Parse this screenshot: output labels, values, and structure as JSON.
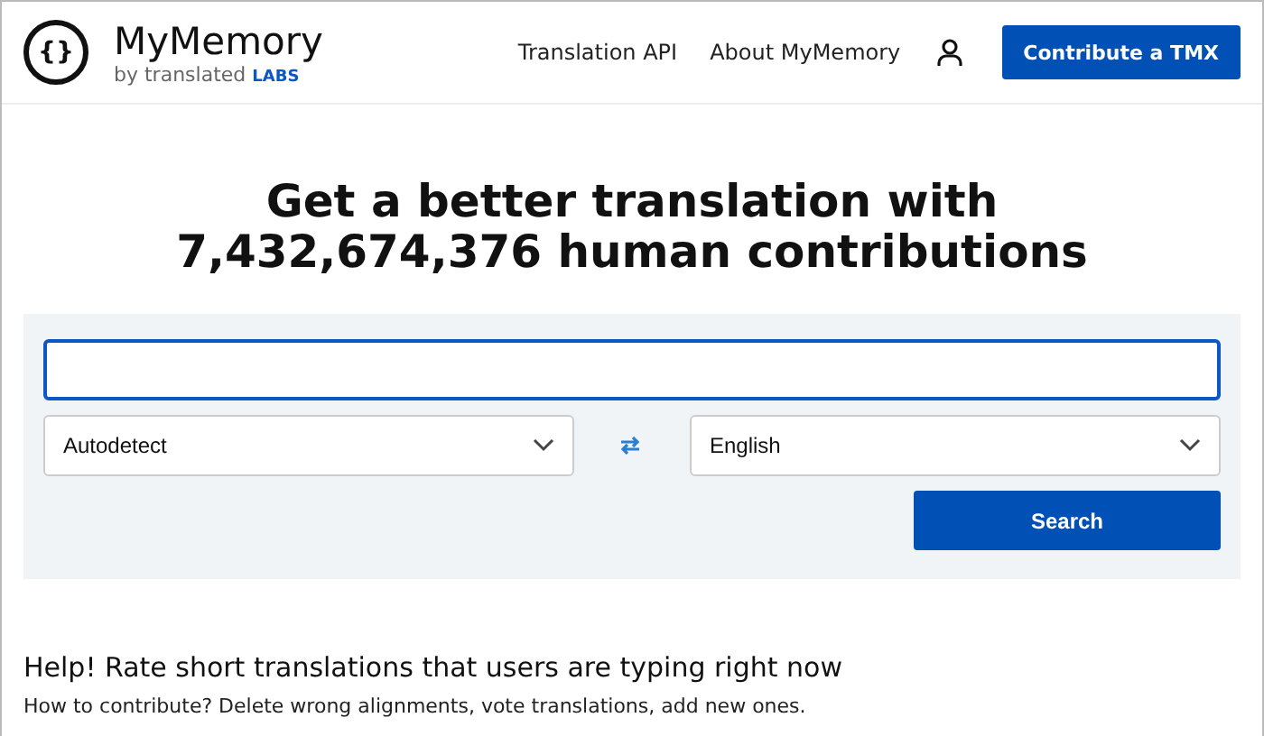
{
  "header": {
    "logo_glyph": "{}",
    "brand": "MyMemory",
    "byline": "by translated",
    "byline_tag": "LABS",
    "nav": [
      "Translation API",
      "About MyMemory"
    ],
    "cta": "Contribute a TMX"
  },
  "headline": [
    "Get a better translation with",
    "7,432,674,376 human contributions"
  ],
  "search": {
    "source": "Autodetect",
    "target": "English",
    "button": "Search"
  },
  "help": {
    "title": "Help! Rate short translations that users are typing right now",
    "subtitle": "How to contribute? Delete wrong alignments, vote translations, add new ones."
  }
}
